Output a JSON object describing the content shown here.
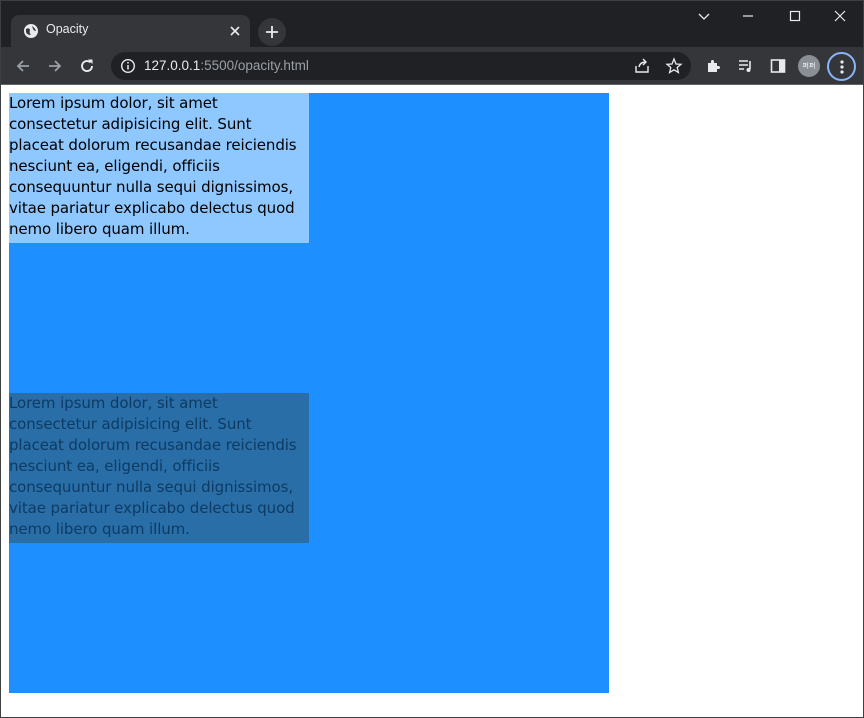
{
  "browser": {
    "tab_title": "Opacity",
    "url_host": "127.0.0.1",
    "url_rest": ":5500/opacity.html",
    "avatar_text": "퍼퍼",
    "icons": [
      "globe-icon",
      "close-icon",
      "plus-icon",
      "chevron-down-icon",
      "minimize-icon",
      "maximize-icon",
      "window-close-icon",
      "back-icon",
      "forward-icon",
      "reload-icon",
      "info-icon",
      "share-icon",
      "star-icon",
      "extensions-icon",
      "media-queue-icon",
      "side-panel-icon",
      "kebab-menu-icon"
    ]
  },
  "page": {
    "box_color": "#1e8fff",
    "paragraph_1": "Lorem ipsum dolor, sit amet consectetur adipisicing elit. Sunt placeat dolorum recusandae reiciendis nesciunt ea, eligendi, officiis consequuntur nulla sequi dignissimos, vitae pariatur explicabo delectus quod nemo libero quam illum.",
    "paragraph_2": "Lorem ipsum dolor, sit amet consectetur adipisicing elit. Sunt placeat dolorum recusandae reiciendis nesciunt ea, eligendi, officiis consequuntur nulla sequi dignissimos, vitae pariatur explicabo delectus quod nemo libero quam illum."
  }
}
